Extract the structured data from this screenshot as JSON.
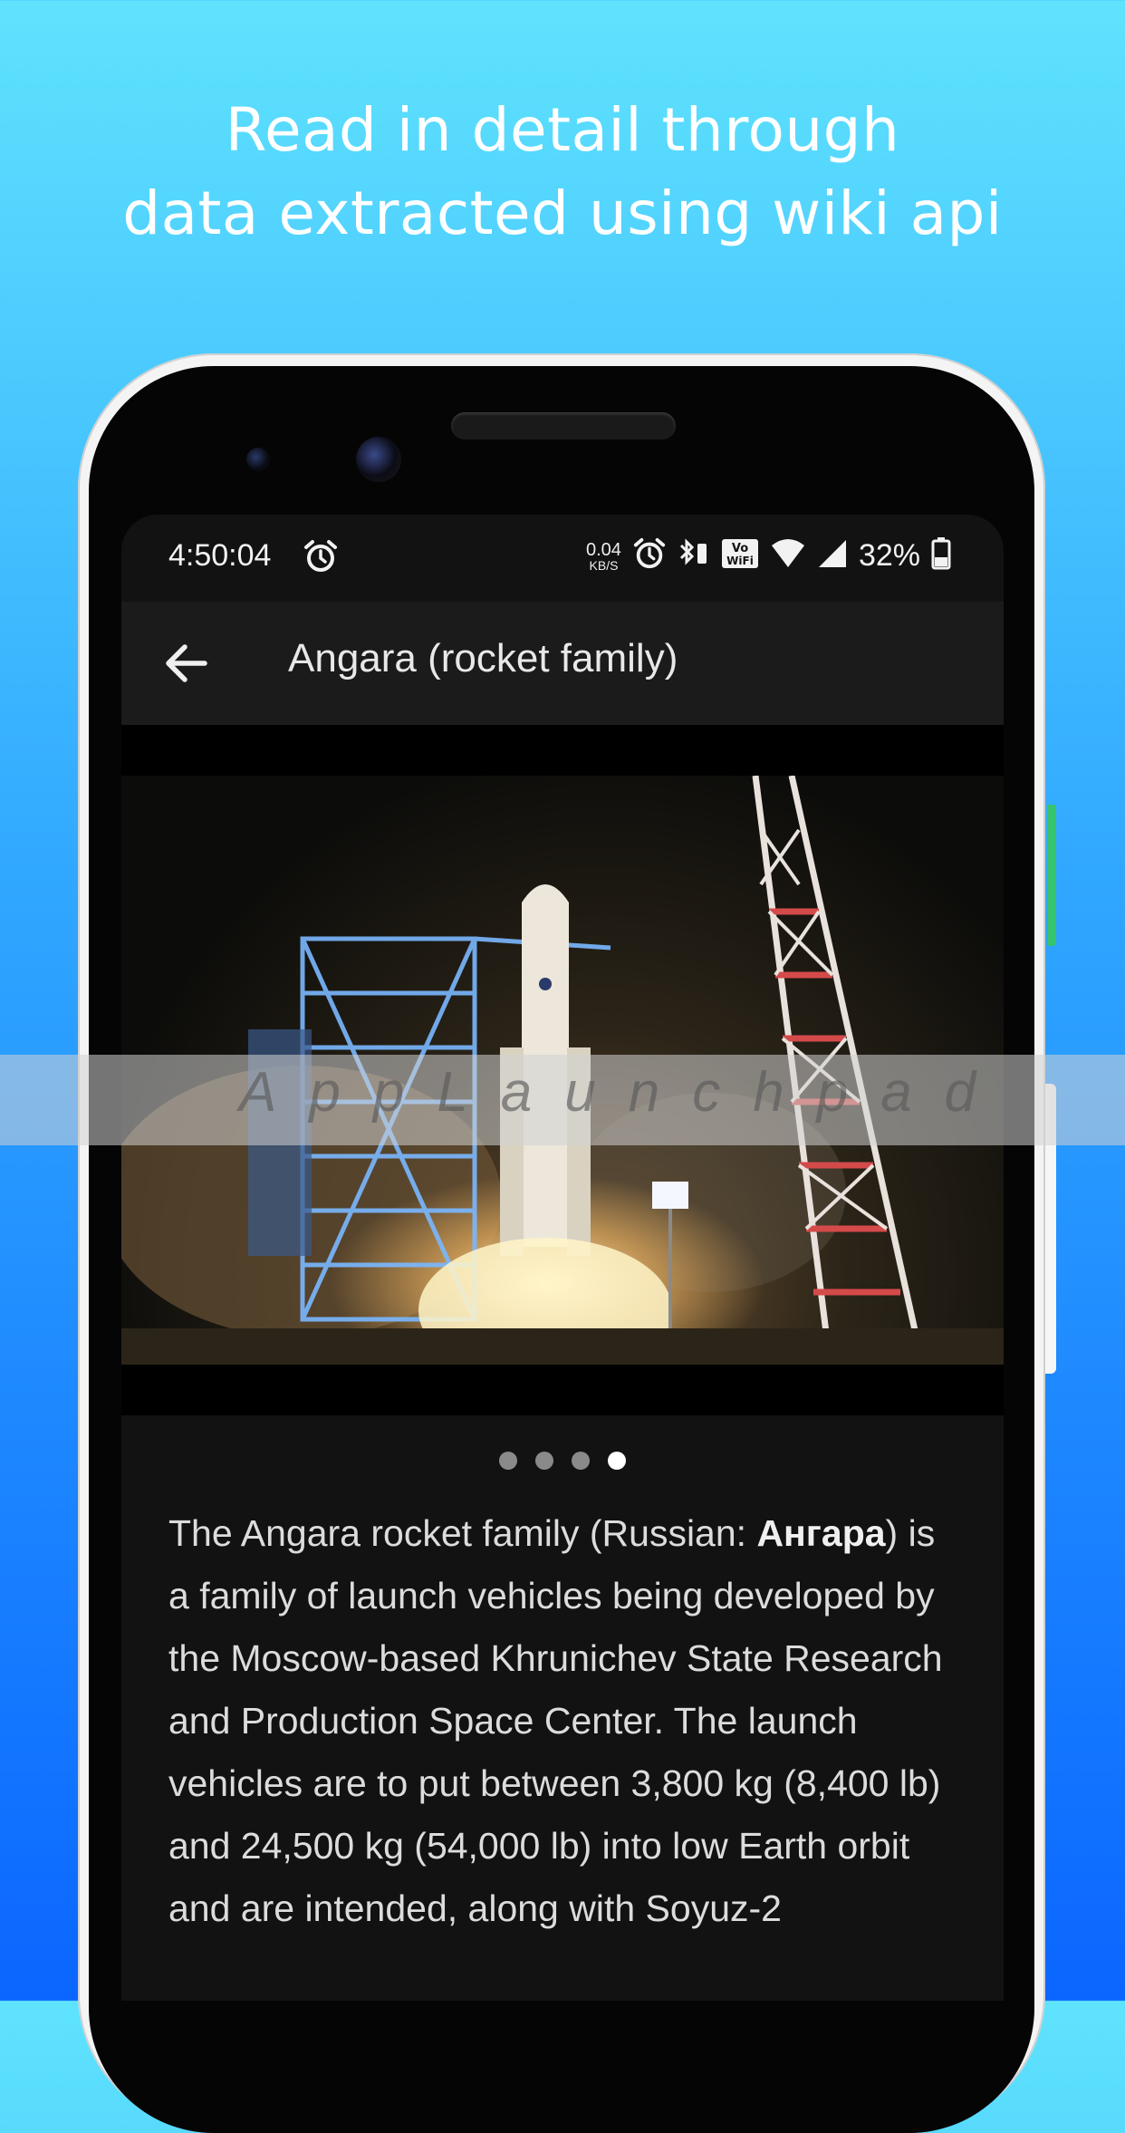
{
  "promo": {
    "line1": "Read in detail through",
    "line2": "data extracted using wiki api"
  },
  "status_bar": {
    "time": "4:50:04",
    "net_speed_value": "0.04",
    "net_speed_unit": "KB/S",
    "battery": "32%",
    "icons": [
      "alarm-icon",
      "alarm-icon",
      "bluetooth-battery-icon",
      "vowifi-icon",
      "wifi-icon",
      "cell-signal-icon",
      "battery-icon"
    ]
  },
  "app_bar": {
    "title": "Angara (rocket family)",
    "back_icon": "arrow-back-icon"
  },
  "gallery": {
    "image_subject": "Angara rocket on launch pad at night",
    "page_count": 4,
    "active_page": 4
  },
  "article": {
    "p1_start": "The Angara rocket family (Russian: ",
    "p1_cyrillic": "Ангара",
    "p1_rest": ") is a family of launch vehicles being developed by the Moscow-based Khrunichev State Research and Production Space Center. The launch vehicles are to put between 3,800 kg (8,400 lb) and 24,500 kg (54,000 lb) into low Earth orbit and are intended, along with Soyuz-2"
  },
  "watermark": {
    "text": "AppLaunchpad"
  },
  "colors": {
    "bg_top": "#5fe3fd",
    "bg_bottom": "#0a66ff",
    "screen_bg": "#121212",
    "appbar_bg": "#1b1b1b"
  }
}
